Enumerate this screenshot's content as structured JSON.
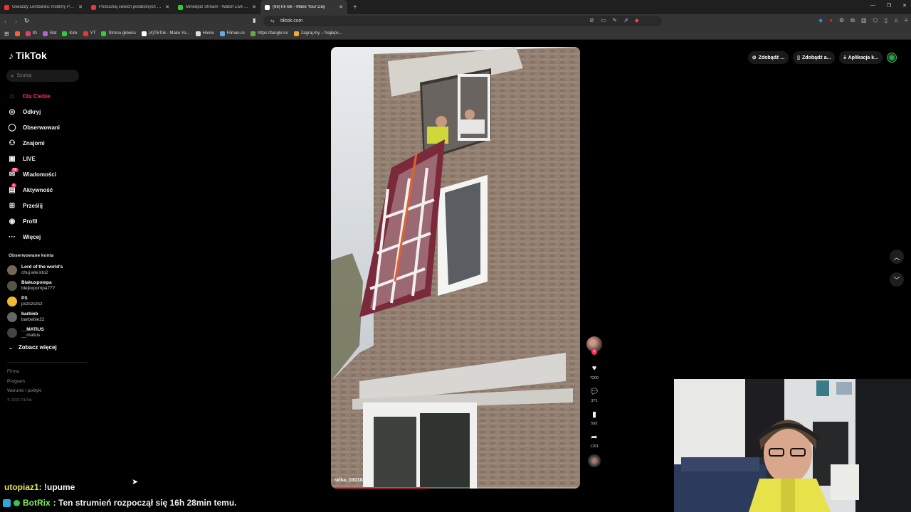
{
  "browser": {
    "tabs": [
      {
        "title": "Gwiazdy Lombardu: Robimy PRAWC...",
        "color": "#e33"
      },
      {
        "title": "Posłuchaj swoich polubionych utwor...",
        "color": "#e33"
      },
      {
        "title": "Minedpl2 Stream - Watch Live on K...",
        "color": "#3c3"
      },
      {
        "title": "(66)TikTok - Make Your Day",
        "color": "#fff",
        "active": true
      }
    ],
    "url": "tiktok.com",
    "bookmarks": [
      {
        "label": "IG",
        "color": "#d46"
      },
      {
        "label": "Rat",
        "color": "#a6c"
      },
      {
        "label": "Kick",
        "color": "#3c3"
      },
      {
        "label": "YT",
        "color": "#e33"
      },
      {
        "label": "Strona główna",
        "color": "#3c3"
      },
      {
        "label": "(4)TikTok - Make Yo...",
        "color": "#fff"
      },
      {
        "label": "Home",
        "color": "#ddd"
      },
      {
        "label": "Filman.cc",
        "color": "#6ad"
      },
      {
        "label": "https://tangle.io/",
        "color": "#6a4"
      },
      {
        "label": "Zagraj.my – Najleps...",
        "color": "#ea3"
      }
    ]
  },
  "tiktok": {
    "logo": "TikTok",
    "search_placeholder": "Szukaj",
    "nav": [
      {
        "label": "Dla Ciebie",
        "icon": "home-icon",
        "glyph": "⌂",
        "active": true
      },
      {
        "label": "Odkryj",
        "icon": "compass-icon",
        "glyph": "◎"
      },
      {
        "label": "Obserwowani",
        "icon": "following-icon",
        "glyph": "◯"
      },
      {
        "label": "Znajomi",
        "icon": "friends-icon",
        "glyph": "⚇"
      },
      {
        "label": "LIVE",
        "icon": "live-icon",
        "glyph": "▣"
      },
      {
        "label": "Wiadomości",
        "icon": "messages-icon",
        "glyph": "✉",
        "badge": "66"
      },
      {
        "label": "Aktywność",
        "icon": "activity-icon",
        "glyph": "▤",
        "badge": "6"
      },
      {
        "label": "Prześlij",
        "icon": "upload-icon",
        "glyph": "⊞"
      },
      {
        "label": "Profil",
        "icon": "profile-icon",
        "glyph": "◉"
      },
      {
        "label": "Więcej",
        "icon": "more-icon",
        "glyph": "···"
      }
    ],
    "followed_title": "Obserwowane konta",
    "accounts": [
      {
        "name": "Lord of the world's",
        "handle": "chuj.wie.kto2",
        "color": "#765"
      },
      {
        "name": "Blakuxpompa",
        "handle": "blejkxpompa777",
        "color": "#554"
      },
      {
        "name": "PS",
        "handle": "pszszszsz",
        "color": "#eb3"
      },
      {
        "name": "barbieb",
        "handle": "barbebie22",
        "color": "#666"
      },
      {
        "name": "__MATIUS",
        "handle": "__matius",
        "color": "#444"
      }
    ],
    "see_more": "Zobacz więcej",
    "footer": [
      "Firma",
      "Program",
      "Warunki i polityki"
    ],
    "copyright": "© 2026 TikTok",
    "top_buttons": [
      "Zdobądź ...",
      "Zdobądź a...",
      "Aplikacja k..."
    ],
    "video": {
      "author": "wika_030102",
      "progress": 0.39,
      "likes": "7200",
      "comments": "371",
      "saves": "592",
      "shares": "1191"
    }
  },
  "stream": {
    "chat": [
      {
        "user": "utopiaz1",
        "message": ": !upume"
      },
      {
        "user": "BotRix",
        "message": ": Ten strumień rozpoczął się 16h 28min temu."
      }
    ]
  }
}
